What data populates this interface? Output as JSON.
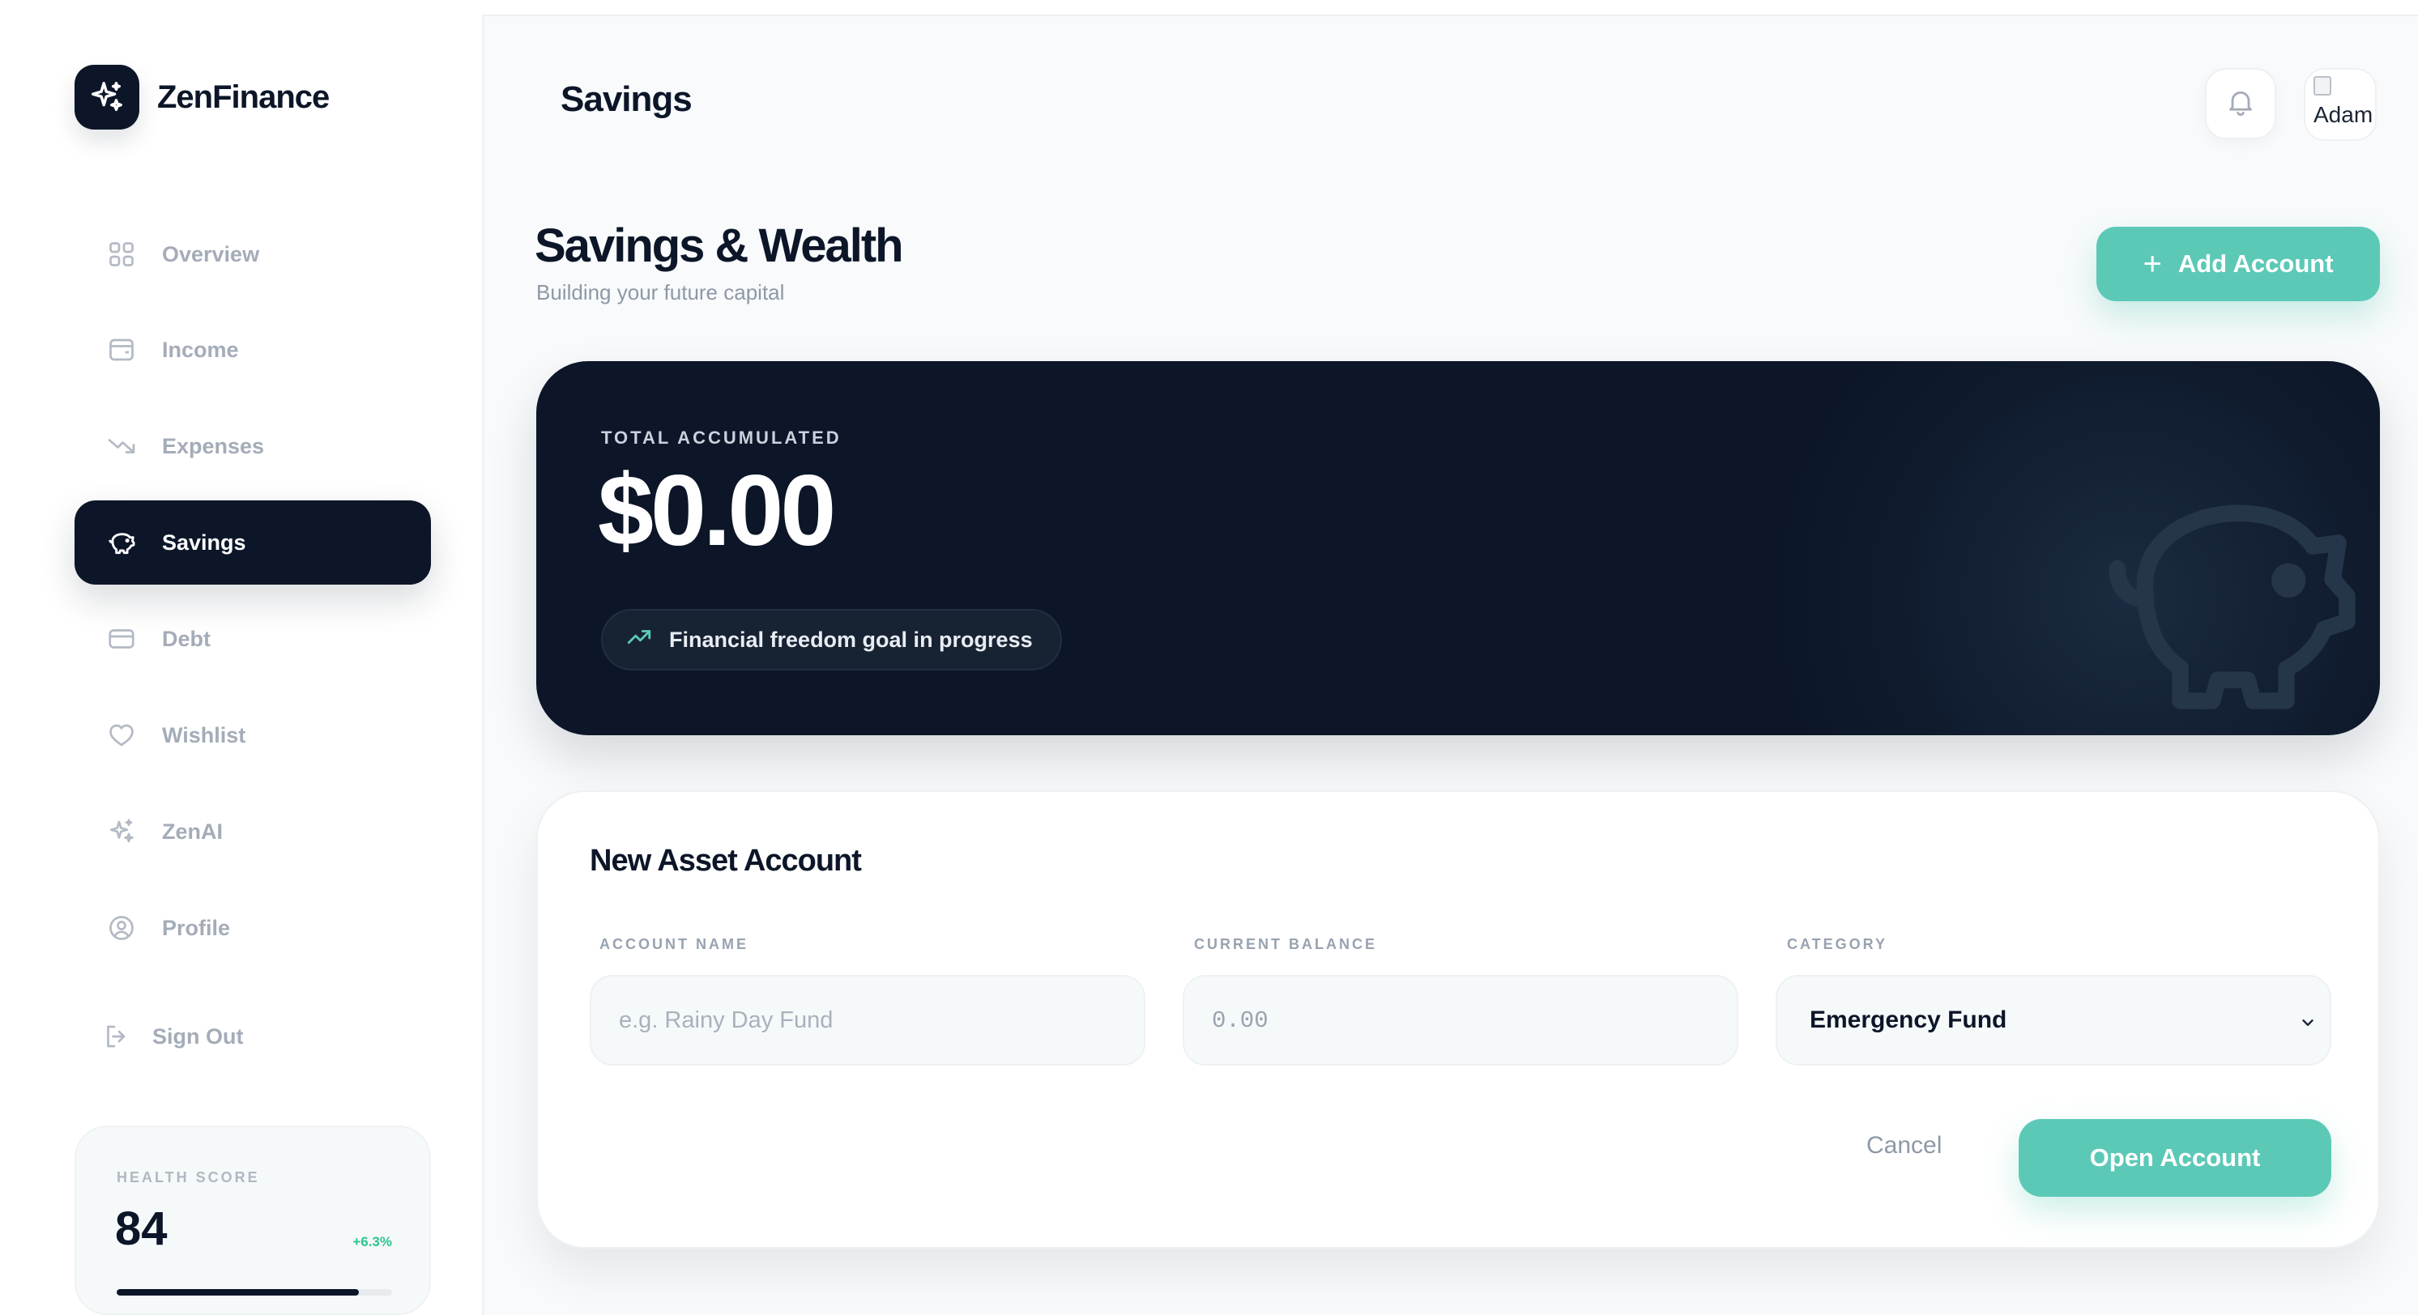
{
  "brand": {
    "name": "ZenFinance"
  },
  "sidebar": {
    "items": [
      {
        "label": "Overview",
        "icon": "grid-icon"
      },
      {
        "label": "Income",
        "icon": "wallet-icon"
      },
      {
        "label": "Expenses",
        "icon": "trending-down-icon"
      },
      {
        "label": "Savings",
        "icon": "piggy-bank-icon",
        "active": true
      },
      {
        "label": "Debt",
        "icon": "credit-card-icon"
      },
      {
        "label": "Wishlist",
        "icon": "heart-icon"
      },
      {
        "label": "ZenAI",
        "icon": "sparkles-icon"
      },
      {
        "label": "Profile",
        "icon": "user-circle-icon"
      },
      {
        "label": "Sign Out",
        "icon": "sign-out-icon"
      }
    ],
    "health": {
      "label": "HEALTH SCORE",
      "score": "84",
      "delta": "+6.3%",
      "progress": 0.88
    }
  },
  "header": {
    "title": "Savings",
    "avatar_alt": "Adam"
  },
  "page": {
    "title": "Savings & Wealth",
    "subtitle": "Building your future capital",
    "add_button": "Add Account"
  },
  "hero": {
    "label": "TOTAL ACCUMULATED",
    "amount": "$0.00",
    "pill": "Financial freedom goal in progress"
  },
  "form": {
    "title": "New Asset Account",
    "name_label": "ACCOUNT NAME",
    "name_placeholder": "e.g. Rainy Day Fund",
    "balance_label": "CURRENT BALANCE",
    "balance_placeholder": "0.00",
    "category_label": "CATEGORY",
    "category_value": "Emergency Fund",
    "cancel": "Cancel",
    "submit": "Open Account"
  },
  "colors": {
    "navy": "#0c1628",
    "accent": "#5cc9b7",
    "positive": "#2ec48e",
    "muted": "#a4acb8"
  }
}
